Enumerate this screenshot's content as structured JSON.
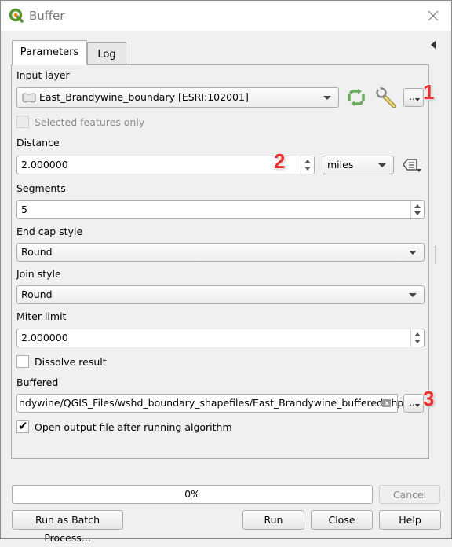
{
  "window": {
    "title": "Buffer",
    "icons": {
      "app": "qgis-logo-icon",
      "close": "close-icon",
      "collapse": "collapse-panel-arrow-icon"
    }
  },
  "tabs": [
    {
      "label": "Parameters",
      "active": true
    },
    {
      "label": "Log",
      "active": false
    }
  ],
  "parameters": {
    "input_layer": {
      "label": "Input layer",
      "value": "East_Brandywine_boundary [ESRI:102001]",
      "layer_icon": "polygon-layer-icon",
      "iterate_icon": "iterate-icon",
      "settings_icon": "wrench-icon",
      "browse_label": "...",
      "annotation": "1"
    },
    "selected_only": {
      "label": "Selected features only",
      "checked": false,
      "enabled": false
    },
    "distance": {
      "label": "Distance",
      "value": "2.000000",
      "unit": "miles",
      "data_defined_icon": "data-defined-override-icon",
      "annotation": "2"
    },
    "segments": {
      "label": "Segments",
      "value": "5"
    },
    "end_cap_style": {
      "label": "End cap style",
      "value": "Round"
    },
    "join_style": {
      "label": "Join style",
      "value": "Round"
    },
    "miter_limit": {
      "label": "Miter limit",
      "value": "2.000000"
    },
    "dissolve": {
      "label": "Dissolve result",
      "checked": false
    },
    "buffered": {
      "label": "Buffered",
      "value": "ndywine/QGIS_Files/wshd_boundary_shapefiles/East_Brandywine_buffered.shp",
      "clear_icon": "clear-input-icon",
      "browse_label": "...",
      "annotation": "3"
    },
    "open_output": {
      "label": "Open output file after running algorithm",
      "checked": true,
      "check_mark": "✔"
    }
  },
  "footer": {
    "progress_text": "0%",
    "progress_percent": 0,
    "cancel_label": "Cancel",
    "batch_label": "Run as Batch Process...",
    "run_label": "Run",
    "close_label": "Close",
    "help_label": "Help"
  }
}
